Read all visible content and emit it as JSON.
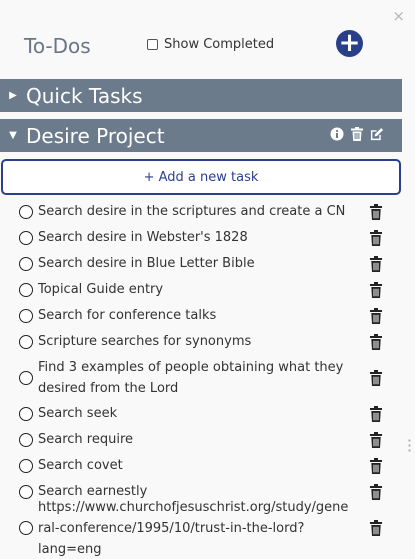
{
  "window": {
    "close_glyph": "×"
  },
  "header": {
    "title": "To-Dos",
    "show_completed_label": "Show Completed",
    "add_glyph": "+"
  },
  "sections": [
    {
      "label": "Quick Tasks",
      "expanded": false
    },
    {
      "label": "Desire Project",
      "expanded": true
    }
  ],
  "desire_project": {
    "add_task_label": "+ Add a new task",
    "tasks": [
      {
        "text": "Search desire in the scriptures and create a CN"
      },
      {
        "text": "Search desire in Webster's 1828"
      },
      {
        "text": "Search desire in Blue Letter Bible"
      },
      {
        "text": "Topical Guide entry"
      },
      {
        "text": "Search for conference talks"
      },
      {
        "text": "Scripture searches for synonyms"
      },
      {
        "text": "Find 3 examples of people obtaining what they desired from the Lord"
      },
      {
        "text": "Search seek"
      },
      {
        "text": "Search require"
      },
      {
        "text": "Search covet"
      },
      {
        "text": "Search earnestly"
      },
      {
        "text": "https://www.churchofjesuschrist.org/study/general-conference/1995/10/trust-in-the-lord?lang=eng"
      }
    ]
  },
  "colors": {
    "section_bar": "#6b7b8c",
    "accent": "#2b3f8c"
  }
}
